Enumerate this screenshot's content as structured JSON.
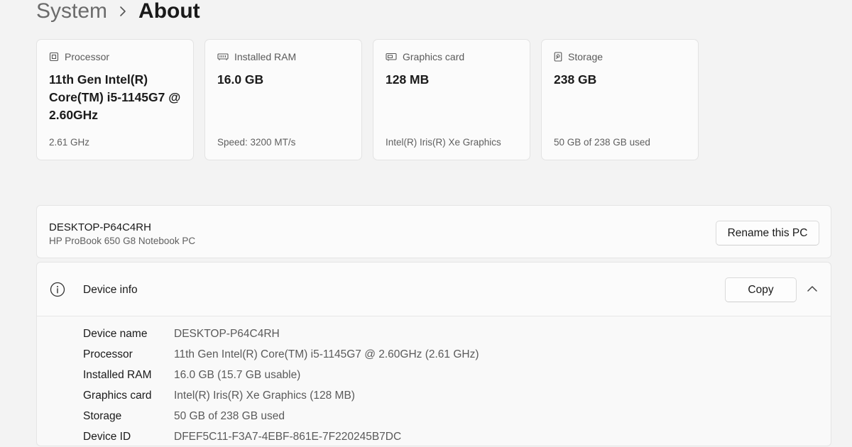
{
  "breadcrumb": {
    "parent": "System",
    "current": "About"
  },
  "cards": [
    {
      "icon": "processor-icon",
      "label": "Processor",
      "value": "11th Gen Intel(R) Core(TM) i5-1145G7 @ 2.60GHz",
      "sub": "2.61 GHz"
    },
    {
      "icon": "ram-icon",
      "label": "Installed RAM",
      "value": "16.0 GB",
      "sub": "Speed: 3200 MT/s"
    },
    {
      "icon": "graphics-card-icon",
      "label": "Graphics card",
      "value": "128 MB",
      "sub": "Intel(R) Iris(R) Xe Graphics"
    },
    {
      "icon": "storage-icon",
      "label": "Storage",
      "value": "238 GB",
      "sub": "50 GB of 238 GB used"
    }
  ],
  "pc": {
    "name": "DESKTOP-P64C4RH",
    "model": "HP ProBook 650 G8 Notebook PC",
    "rename_label": "Rename this PC"
  },
  "device_info": {
    "title": "Device info",
    "copy_label": "Copy",
    "rows": [
      {
        "label": "Device name",
        "value": "DESKTOP-P64C4RH"
      },
      {
        "label": "Processor",
        "value": "11th Gen Intel(R) Core(TM) i5-1145G7 @ 2.60GHz (2.61 GHz)"
      },
      {
        "label": "Installed RAM",
        "value": "16.0 GB (15.7 GB usable)"
      },
      {
        "label": "Graphics card",
        "value": "Intel(R) Iris(R) Xe Graphics (128 MB)"
      },
      {
        "label": "Storage",
        "value": "50 GB of 238 GB used"
      },
      {
        "label": "Device ID",
        "value": "DFEF5C11-F3A7-4EBF-861E-7F220245B7DC"
      }
    ]
  }
}
